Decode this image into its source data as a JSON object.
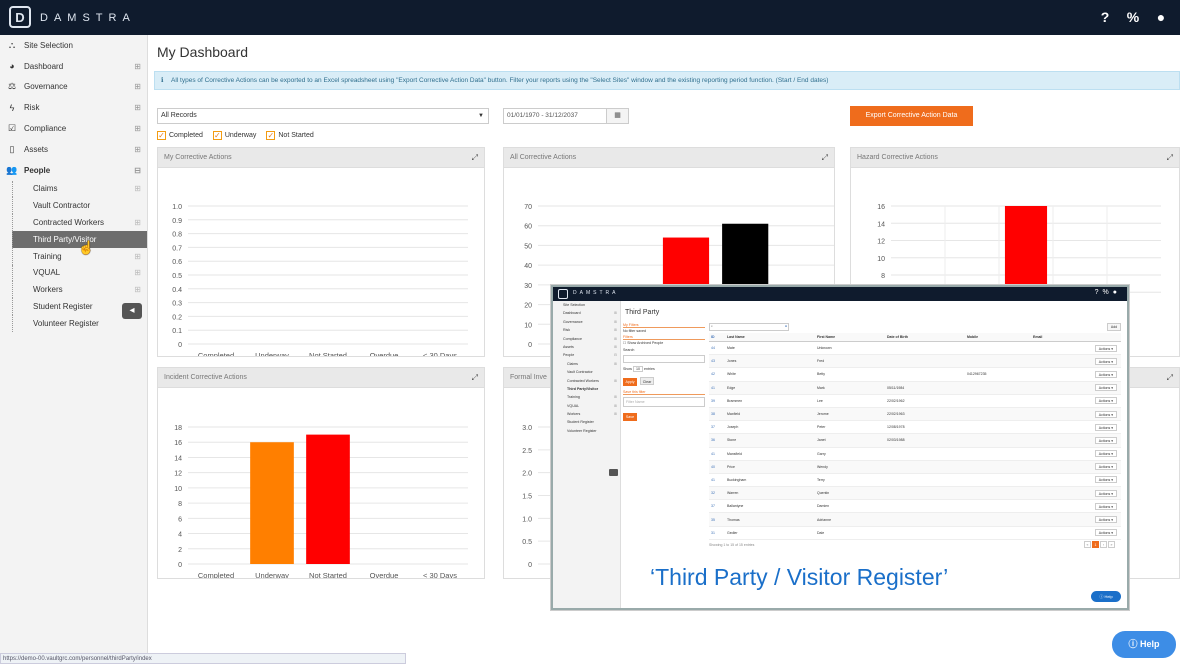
{
  "app": {
    "brand": "DAMSTRA",
    "logo_letter": "D"
  },
  "topbar_icons": [
    "help-icon",
    "sitemap-icon",
    "user-icon"
  ],
  "sidebar": {
    "items": [
      {
        "label": "Site Selection",
        "icon": "sitemap-icon",
        "glyph": "⛬"
      },
      {
        "label": "Dashboard",
        "icon": "dashboard-icon",
        "glyph": "◕",
        "plus": "⊞"
      },
      {
        "label": "Governance",
        "icon": "governance-icon",
        "glyph": "⚖",
        "plus": "⊞"
      },
      {
        "label": "Risk",
        "icon": "bolt-icon",
        "glyph": "ϟ",
        "plus": "⊞"
      },
      {
        "label": "Compliance",
        "icon": "check-square-icon",
        "glyph": "☑",
        "plus": "⊞"
      },
      {
        "label": "Assets",
        "icon": "tablet-icon",
        "glyph": "▯",
        "plus": "⊞"
      },
      {
        "label": "People",
        "icon": "users-icon",
        "glyph": "👥",
        "plus": "⊟"
      }
    ],
    "people_sub": [
      {
        "label": "Claims",
        "plus": "⊞"
      },
      {
        "label": "Vault Contractor",
        "plus": ""
      },
      {
        "label": "Contracted Workers",
        "plus": "⊞"
      },
      {
        "label": "Third Party/Visitor",
        "plus": "",
        "active": true
      },
      {
        "label": "Training",
        "plus": "⊞"
      },
      {
        "label": "VQUAL",
        "plus": "⊞"
      },
      {
        "label": "Workers",
        "plus": "⊞"
      },
      {
        "label": "Student Register",
        "plus": ""
      },
      {
        "label": "Volunteer Register",
        "plus": ""
      }
    ]
  },
  "status_url": "https://demo-00.vaultgrc.com/personnel/thirdParty/index",
  "page": {
    "title": "My Dashboard",
    "info": "All types of Corrective Actions can be exported to an Excel spreadsheet using \"Export Corrective Action Data\" button. Filter your reports using the \"Select Sites\" window and the existing reporting period function. (Start / End dates)",
    "select_value": "All Records",
    "date_range": "01/01/1970 - 31/12/2037",
    "export_label": "Export Corrective Action Data",
    "checks": [
      "Completed",
      "Underway",
      "Not Started"
    ]
  },
  "panels": {
    "my_ca": "My Corrective Actions",
    "all_ca": "All Corrective Actions",
    "hazard_ca": "Hazard Corrective Actions",
    "incident_ca": "Incident Corrective Actions",
    "formal_inv": "Formal Inve"
  },
  "chart_data": [
    {
      "type": "bar",
      "title": "My Corrective Actions",
      "categories": [
        "Completed",
        "Underway",
        "Not Started",
        "Overdue",
        "< 30 Days"
      ],
      "values": [
        0,
        0,
        0,
        0,
        0
      ],
      "ylim": [
        0,
        1.0
      ],
      "yticks": [
        "0",
        "0.1",
        "0.2",
        "0.3",
        "0.4",
        "0.5",
        "0.6",
        "0.7",
        "0.8",
        "0.9",
        "1.0"
      ]
    },
    {
      "type": "bar",
      "title": "All Corrective Actions",
      "categories": [
        "Completed",
        "Underway",
        "Not Started",
        "Overdue",
        "< 30 Days"
      ],
      "values": [
        null,
        26,
        54,
        61,
        null
      ],
      "colors": [
        "#ff7f00",
        "#ff7f00",
        "#ff0000",
        "#000000",
        "#999999"
      ],
      "ylim": [
        0,
        70
      ],
      "yticks": [
        "0",
        "10",
        "20",
        "30",
        "40",
        "50",
        "60",
        "70"
      ]
    },
    {
      "type": "bar",
      "title": "Hazard Corrective Actions",
      "categories": [
        "Completed",
        "Underway",
        "Not Started",
        "Overdue",
        "< 30 Days"
      ],
      "values": [
        null,
        null,
        16,
        null,
        null
      ],
      "colors": [
        "#ff7f00",
        "#ff7f00",
        "#ff0000",
        "#000000",
        "#999999"
      ],
      "ylim": [
        0,
        16
      ],
      "yticks": [
        "6",
        "8",
        "10",
        "12",
        "14",
        "16"
      ]
    },
    {
      "type": "bar",
      "title": "Incident Corrective Actions",
      "categories": [
        "Completed",
        "Underway",
        "Not Started",
        "Overdue",
        "< 30 Days"
      ],
      "values": [
        0,
        16,
        17,
        0,
        0
      ],
      "colors": [
        "#ff7f00",
        "#ff7f00",
        "#ff0000",
        "#000000",
        "#999999"
      ],
      "ylim": [
        0,
        18
      ],
      "yticks": [
        "0",
        "2",
        "4",
        "6",
        "8",
        "10",
        "12",
        "14",
        "16",
        "18"
      ]
    },
    {
      "type": "bar",
      "title": "Formal Inve",
      "categories": [],
      "values": [],
      "ylim": [
        0,
        3.0
      ],
      "yticks": [
        "0",
        "0.5",
        "1.0",
        "1.5",
        "2.0",
        "2.5",
        "3.0"
      ]
    }
  ],
  "popup": {
    "brand": "DAMSTRA",
    "title": "Third Party",
    "my_filters": "My Filters",
    "no_filter": "No filter saved",
    "filters": "Filters",
    "show_archived": "Show Archived People",
    "search": "Search",
    "show": "Show",
    "entries": "entries",
    "show_count": "10",
    "apply": "Apply",
    "clear": "Clear",
    "save_filter": "Save this filter",
    "filter_name_ph": "Filter Name",
    "save": "Save",
    "add": "Add",
    "columns": [
      "ID",
      "Last Name",
      "First Name",
      "Date of Birth",
      "Mobile",
      "Email"
    ],
    "rows": [
      {
        "id": "44",
        "last": "Mate",
        "first": "Unknown",
        "dob": "",
        "mobile": ""
      },
      {
        "id": "43",
        "last": "Jones",
        "first": "Fred",
        "dob": "",
        "mobile": ""
      },
      {
        "id": "42",
        "last": "White",
        "first": "Betty",
        "dob": "",
        "mobile": "0412967235"
      },
      {
        "id": "41",
        "last": "Edge",
        "first": "Mark",
        "dob": "05/11/1984",
        "mobile": ""
      },
      {
        "id": "39",
        "last": "Brammen",
        "first": "Lee",
        "dob": "22/02/1962",
        "mobile": ""
      },
      {
        "id": "38",
        "last": "Maxfield",
        "first": "Jerome",
        "dob": "22/02/1963",
        "mobile": ""
      },
      {
        "id": "37",
        "last": "Joseph",
        "first": "Peter",
        "dob": "12/08/1978",
        "mobile": ""
      },
      {
        "id": "36",
        "last": "Stone",
        "first": "Janet",
        "dob": "02/03/1988",
        "mobile": ""
      },
      {
        "id": "41",
        "last": "Mansfield",
        "first": "Garry",
        "dob": "",
        "mobile": ""
      },
      {
        "id": "40",
        "last": "Price",
        "first": "Wendy",
        "dob": "",
        "mobile": ""
      },
      {
        "id": "41",
        "last": "Buckingham",
        "first": "Terry",
        "dob": "",
        "mobile": ""
      },
      {
        "id": "32",
        "last": "Warren",
        "first": "Quentin",
        "dob": "",
        "mobile": ""
      },
      {
        "id": "37",
        "last": "Ballantyne",
        "first": "Damien",
        "dob": "",
        "mobile": ""
      },
      {
        "id": "35",
        "last": "Thomas",
        "first": "Adrianne",
        "dob": "",
        "mobile": ""
      },
      {
        "id": "31",
        "last": "Gedler",
        "first": "Dale",
        "dob": "",
        "mobile": ""
      }
    ],
    "actions_label": "Actions ▾",
    "footer": "Showing 1 to 15 of 15 entries",
    "caption": "‘Third Party / Visitor Register’",
    "help": "Help"
  },
  "help_button": "Help",
  "colors": {
    "topbar": "#0f1b2d",
    "accent": "#ef6c1c",
    "link": "#1a6fc9"
  }
}
